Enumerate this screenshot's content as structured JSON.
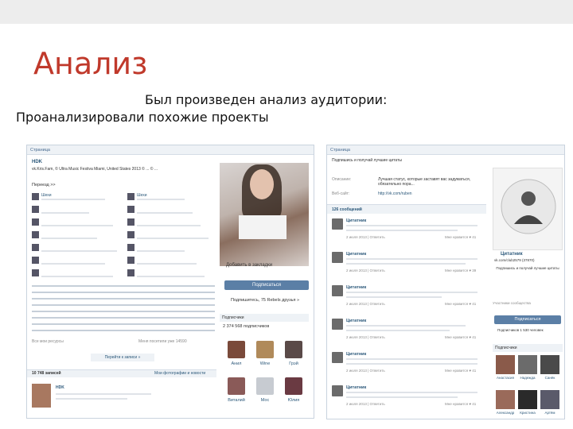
{
  "slide": {
    "title": "Анализ",
    "line1": "Был произведен анализ аудитории:",
    "line2": "Проанализировали похожие проекты"
  },
  "left_screenshot": {
    "header": "Страница",
    "page_name": "HDK",
    "page_info": "vk.Kris.Fam,  © Ultra Music Festiva Miami, United States 2013 © ... © ...",
    "say_hello": "Переезд >>",
    "feed_author": "Шехи",
    "add_bookmark": "Добавить в закладки",
    "subscribe_button": "Подписаться",
    "subscribe_note": "Подпишитесь, 75 Rebels друзья »",
    "subscribers_label": "Подписчики",
    "subscribers_count": "2 374 568 подписчиков",
    "footer_left": "Все мои ресурсы",
    "footer_stats": "Меня посетили уже 14590",
    "more_link": "Перейти к записи »",
    "wall_count": "10 748 записей",
    "wall_link": "Мои фотографии и новости",
    "post_author": "HDK",
    "subscribers": [
      {
        "name": "Анил",
        "color": "#7a4a3a"
      },
      {
        "name": "Wine",
        "color": "#b08a5a"
      },
      {
        "name": "Грэй",
        "color": "#5a4a48"
      },
      {
        "name": "Виталий",
        "color": "#8a5a58"
      },
      {
        "name": "Мос",
        "color": "#c7cbd1"
      },
      {
        "name": "Юлия",
        "color": "#6a3a42"
      }
    ]
  },
  "right_screenshot": {
    "header": "Страница",
    "subscribe_prompt": "Подпишись и получай лучшие цитаты",
    "desc_label": "Описание:",
    "desc_text": "Лучшая статус, которые заставят вас задуматься, обязательно пора...",
    "website_label": "Веб-сайт:",
    "website_text": "http://vk.com/ruben",
    "wall_header": "126 сообщений",
    "posts": [
      {
        "title": "Цитатник",
        "date": "2 июля 2013 | Ответить",
        "likes": "Мне нравится ♥ 41"
      },
      {
        "title": "Цитатник",
        "date": "2 июля 2013 | Ответить",
        "likes": "Мне нравится ♥ 39"
      },
      {
        "title": "Цитатник",
        "date": "2 июля 2013 | Ответить",
        "likes": "Мне нравится ♥ 41"
      },
      {
        "title": "Цитатник",
        "date": "2 июля 2013 | Ответить",
        "likes": "Мне нравится ♥ 41"
      },
      {
        "title": "Цитатник",
        "date": "2 июля 2013 | Ответить",
        "likes": "Мне нравится ♥ 41"
      },
      {
        "title": "Цитатник",
        "date": "2 июля 2013 | Ответить",
        "likes": "Мне нравится ♥ 41"
      }
    ],
    "group_name": "Цитатник",
    "group_url": "vk.com/club2579 (37870)",
    "side_caption": "Подпишись и получай лучшие цитаты",
    "community_label": "Участники сообщества",
    "side_button": "Подписаться",
    "side_count": "Подписчиков 1 530 человек",
    "members_label": "Подписчики",
    "members": [
      {
        "name": "Анастасия",
        "color": "#8a5a4a"
      },
      {
        "name": "Надежда",
        "color": "#6b6b6b"
      },
      {
        "name": "Санёк",
        "color": "#4a4a4a"
      },
      {
        "name": "Александр",
        "color": "#9a6a5a"
      },
      {
        "name": "Кристина",
        "color": "#2a2a2a"
      },
      {
        "name": "Артём",
        "color": "#5a5a6a"
      }
    ]
  }
}
